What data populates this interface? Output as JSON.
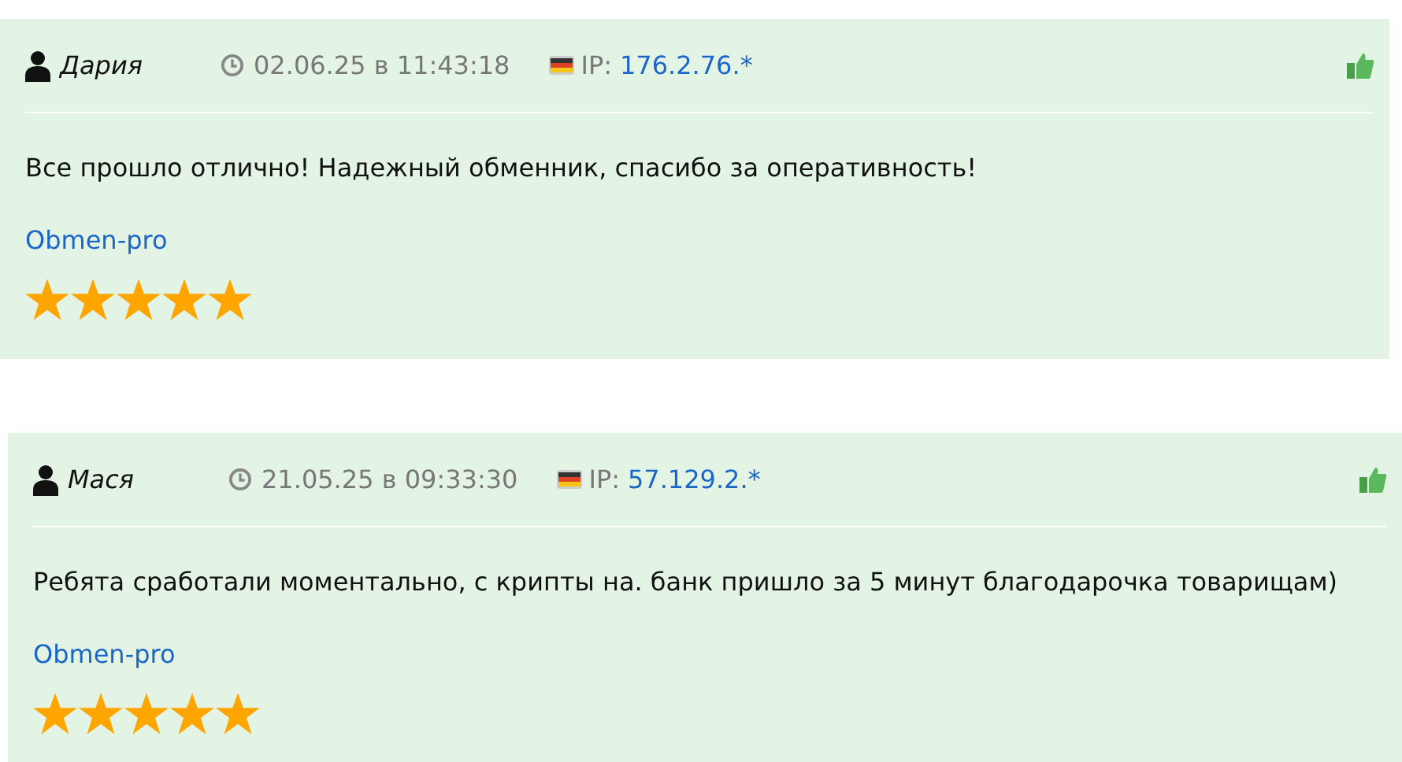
{
  "reviews": [
    {
      "author": "Дария",
      "datetime": "02.06.25 в 11:43:18",
      "ip_label": "IP:",
      "ip": "176.2.76.*",
      "text": "Все прошло отлично! Надежный обменник, спасибо за оперативность!",
      "service": "Obmen-pro",
      "stars": 5
    },
    {
      "author": "Мася",
      "datetime": "21.05.25 в 09:33:30",
      "ip_label": "IP:",
      "ip": "57.129.2.*",
      "text": "Ребята сработали моментально, с крипты на. банк пришло за 5 минут благодарочка товарищам)",
      "service": "Obmen-pro",
      "stars": 5
    }
  ]
}
